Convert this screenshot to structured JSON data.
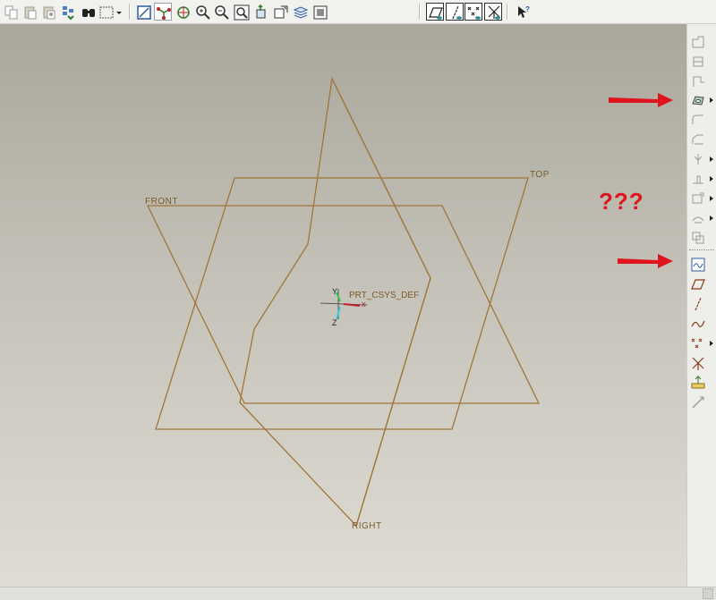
{
  "toolbar": {
    "icons": [
      "copy-icon",
      "paste-icon",
      "paste-special-icon",
      "regenerate-icon",
      "find-icon",
      "selection-filter-icon",
      "dropdown-arrow-icon",
      "repaint-icon",
      "orient-mode-icon",
      "spin-center-icon",
      "zoom-in-icon",
      "zoom-out-icon",
      "refit-icon",
      "reorient-icon",
      "saved-views-icon",
      "layers-icon",
      "view-manager-icon",
      "datum-planes-display-icon",
      "datum-axes-display-icon",
      "datum-points-display-icon",
      "csys-display-icon",
      "context-help-icon"
    ]
  },
  "viewport": {
    "planes": {
      "front": "FRONT",
      "top": "TOP",
      "right": "RIGHT"
    },
    "csys": {
      "name": "PRT_CSYS_DEF",
      "x": "x",
      "y": "Y",
      "z": "Z"
    },
    "annotation": "???",
    "colors": {
      "plane": "#a0763a",
      "annotation": "#e0141c",
      "arrow": "#e0141c"
    }
  },
  "rightbar": {
    "feature_icons": [
      "extrude-icon",
      "revolve-icon",
      "sweep-icon",
      "hole-tool-icon",
      "round-tool-icon",
      "chamfer-tool-icon",
      "draft-tool-icon",
      "shell-tool-icon",
      "rib-tool-icon",
      "pattern-tool-icon",
      "mirror-tool-icon"
    ],
    "datum_icons": [
      "sketch-tool-icon",
      "datum-plane-icon",
      "datum-axis-icon",
      "datum-curve-icon",
      "datum-point-icon",
      "datum-csys-icon",
      "analysis-feature-icon",
      "insert-mode-icon"
    ]
  }
}
